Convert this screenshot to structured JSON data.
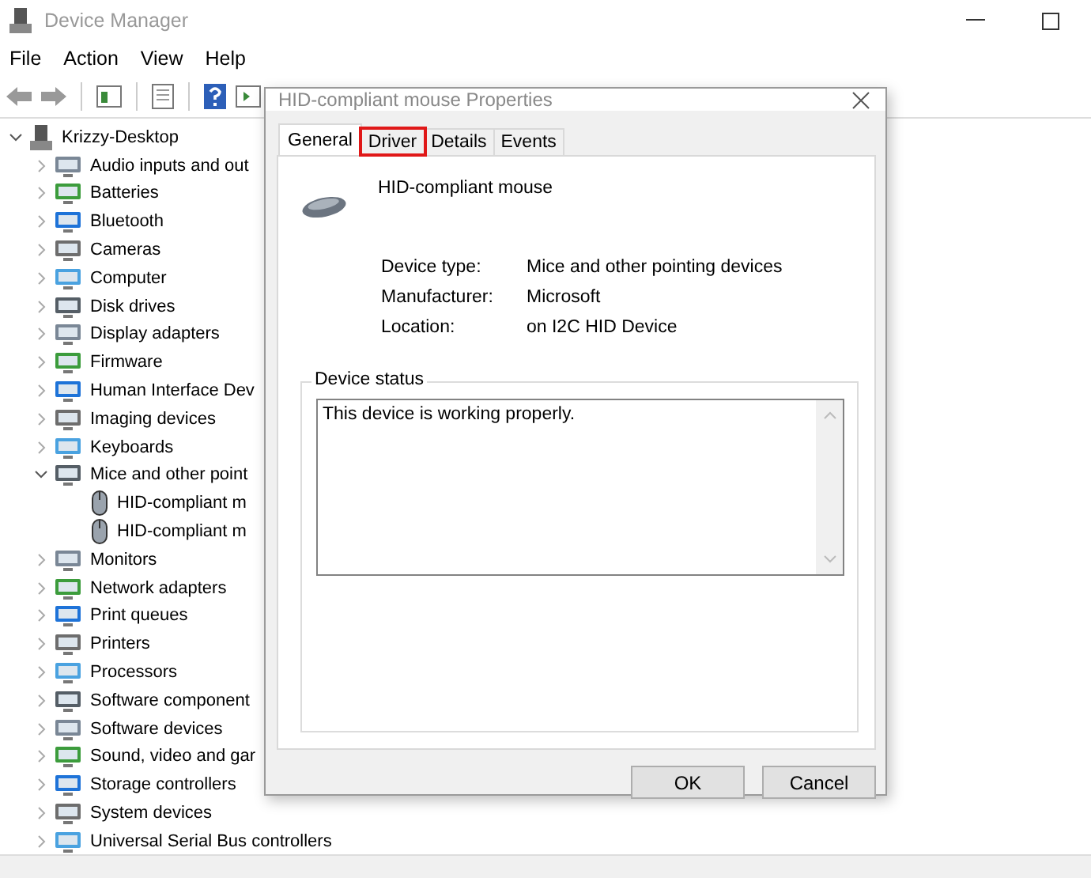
{
  "window": {
    "title": "Device Manager"
  },
  "menu": [
    "File",
    "Action",
    "View",
    "Help"
  ],
  "tree": {
    "label": "Krizzy-Desktop",
    "expanded": true,
    "children": [
      {
        "label": "Audio inputs and out",
        "expanded": false
      },
      {
        "label": "Batteries",
        "expanded": false
      },
      {
        "label": "Bluetooth",
        "expanded": false
      },
      {
        "label": "Cameras",
        "expanded": false
      },
      {
        "label": "Computer",
        "expanded": false
      },
      {
        "label": "Disk drives",
        "expanded": false
      },
      {
        "label": "Display adapters",
        "expanded": false
      },
      {
        "label": "Firmware",
        "expanded": false
      },
      {
        "label": "Human Interface Dev",
        "expanded": false
      },
      {
        "label": "Imaging devices",
        "expanded": false
      },
      {
        "label": "Keyboards",
        "expanded": false
      },
      {
        "label": "Mice and other point",
        "expanded": true,
        "children": [
          {
            "label": "HID-compliant m"
          },
          {
            "label": "HID-compliant m"
          }
        ]
      },
      {
        "label": "Monitors",
        "expanded": false
      },
      {
        "label": "Network adapters",
        "expanded": false
      },
      {
        "label": "Print queues",
        "expanded": false
      },
      {
        "label": "Printers",
        "expanded": false
      },
      {
        "label": "Processors",
        "expanded": false
      },
      {
        "label": "Software component",
        "expanded": false
      },
      {
        "label": "Software devices",
        "expanded": false
      },
      {
        "label": "Sound, video and gar",
        "expanded": false
      },
      {
        "label": "Storage controllers",
        "expanded": false
      },
      {
        "label": "System devices",
        "expanded": false
      },
      {
        "label": "Universal Serial Bus controllers",
        "expanded": false
      }
    ]
  },
  "dialog": {
    "title": "HID-compliant mouse Properties",
    "tabs": [
      {
        "label": "General",
        "selected": true,
        "highlighted": false
      },
      {
        "label": "Driver",
        "selected": false,
        "highlighted": true
      },
      {
        "label": "Details",
        "selected": false,
        "highlighted": false
      },
      {
        "label": "Events",
        "selected": false,
        "highlighted": false
      }
    ],
    "device_name": "HID-compliant mouse",
    "properties": [
      {
        "label": "Device type:",
        "value": "Mice and other pointing devices"
      },
      {
        "label": "Manufacturer:",
        "value": "Microsoft"
      },
      {
        "label": "Location:",
        "value": "on I2C HID Device"
      }
    ],
    "status_group": {
      "title": "Device status",
      "text": "This device is working properly."
    },
    "buttons": [
      "OK",
      "Cancel"
    ]
  }
}
